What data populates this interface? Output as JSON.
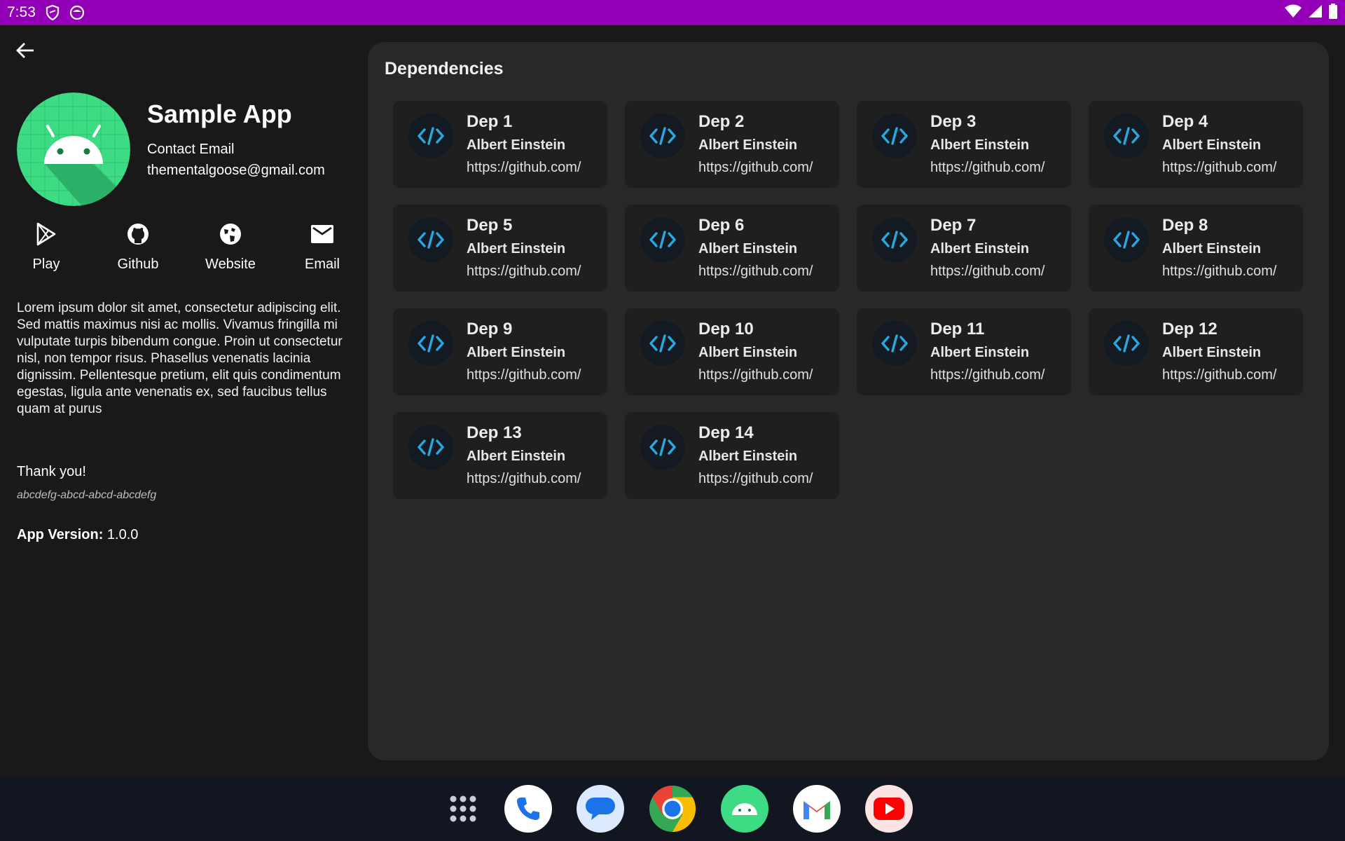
{
  "status_bar": {
    "time": "7:53"
  },
  "app": {
    "name": "Sample App",
    "contact_label": "Contact Email",
    "contact_email": "thementalgoose@gmail.com",
    "description": "Lorem ipsum dolor sit amet, consectetur adipiscing elit. Sed mattis maximus nisi ac mollis. Vivamus fringilla mi vulputate turpis bibendum congue. Proin ut consectetur nisl, non tempor risus. Phasellus venenatis lacinia dignissim. Pellentesque pretium, elit quis condimentum egestas, ligula ante venenatis ex, sed faucibus tellus quam at purus",
    "thanks": "Thank you!",
    "uuid": "abcdefg-abcd-abcd-abcdefg",
    "version_label": "App Version:",
    "version_value": "1.0.0"
  },
  "links": [
    {
      "label": "Play",
      "icon": "play-store-icon"
    },
    {
      "label": "Github",
      "icon": "github-icon"
    },
    {
      "label": "Website",
      "icon": "globe-icon"
    },
    {
      "label": "Email",
      "icon": "email-icon"
    }
  ],
  "dependencies_title": "Dependencies",
  "dependencies": [
    {
      "name": "Dep 1",
      "author": "Albert Einstein",
      "url": "https://github.com/"
    },
    {
      "name": "Dep 2",
      "author": "Albert Einstein",
      "url": "https://github.com/"
    },
    {
      "name": "Dep 3",
      "author": "Albert Einstein",
      "url": "https://github.com/"
    },
    {
      "name": "Dep 4",
      "author": "Albert Einstein",
      "url": "https://github.com/"
    },
    {
      "name": "Dep 5",
      "author": "Albert Einstein",
      "url": "https://github.com/"
    },
    {
      "name": "Dep 6",
      "author": "Albert Einstein",
      "url": "https://github.com/"
    },
    {
      "name": "Dep 7",
      "author": "Albert Einstein",
      "url": "https://github.com/"
    },
    {
      "name": "Dep 8",
      "author": "Albert Einstein",
      "url": "https://github.com/"
    },
    {
      "name": "Dep 9",
      "author": "Albert Einstein",
      "url": "https://github.com/"
    },
    {
      "name": "Dep 10",
      "author": "Albert Einstein",
      "url": "https://github.com/"
    },
    {
      "name": "Dep 11",
      "author": "Albert Einstein",
      "url": "https://github.com/"
    },
    {
      "name": "Dep 12",
      "author": "Albert Einstein",
      "url": "https://github.com/"
    },
    {
      "name": "Dep 13",
      "author": "Albert Einstein",
      "url": "https://github.com/"
    },
    {
      "name": "Dep 14",
      "author": "Albert Einstein",
      "url": "https://github.com/"
    }
  ],
  "dock": [
    "app-drawer-icon",
    "phone-icon",
    "messages-icon",
    "chrome-icon",
    "sample-app-icon",
    "gmail-icon",
    "youtube-icon"
  ],
  "colors": {
    "status_bar": "#9400b8",
    "background": "#191919",
    "panel": "#282828",
    "card": "#1f1f1f",
    "accent_code": "#29a8e0",
    "logo_green": "#3ddc84"
  }
}
